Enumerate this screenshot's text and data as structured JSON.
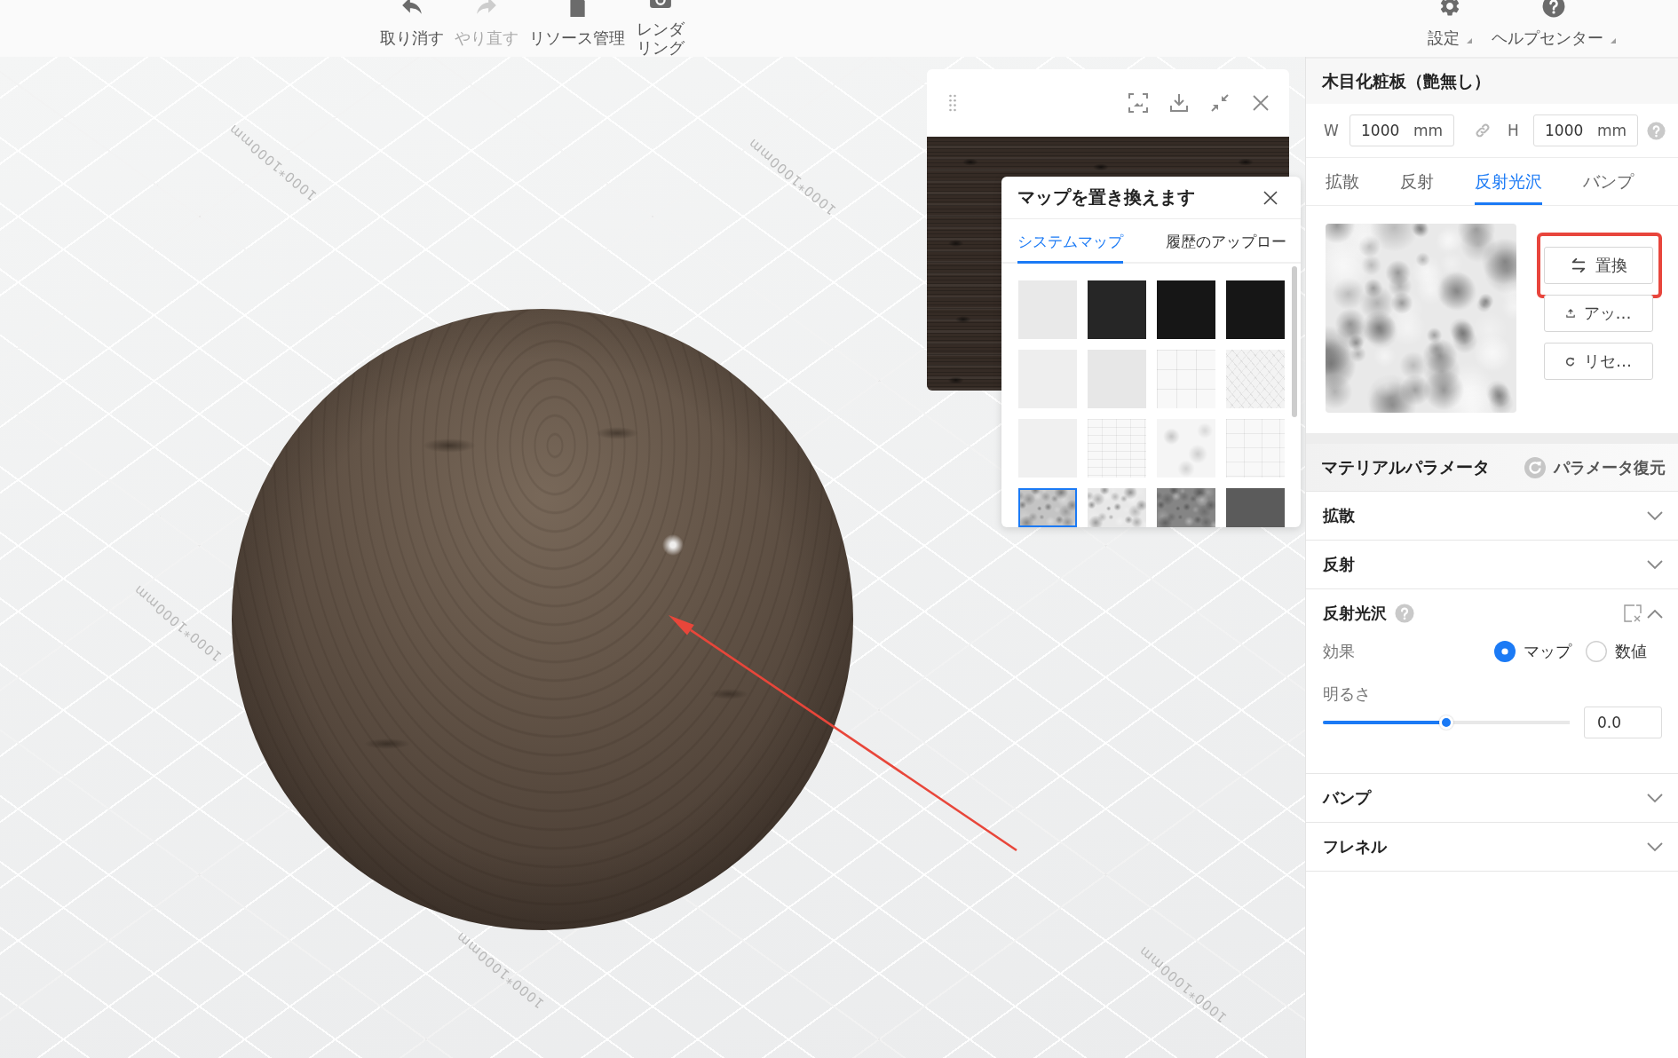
{
  "toolbar": {
    "items": [
      {
        "kind": "undo",
        "label": "取り消す",
        "disabled": false
      },
      {
        "kind": "redo",
        "label": "やり直す",
        "disabled": true
      },
      {
        "kind": "folder",
        "label": "リソース管理",
        "disabled": false
      },
      {
        "kind": "camera",
        "label": "レンダリング",
        "disabled": false
      }
    ],
    "menus": [
      {
        "kind": "gear",
        "label": "設定",
        "dropdown": true
      },
      {
        "kind": "help",
        "label": "ヘルプセンター",
        "dropdown": true
      }
    ]
  },
  "viewport": {
    "floor_labels": [
      "1000*1000mm",
      "1000*1000mm",
      "1000*1000mm",
      "1000*1000mm",
      "1000*1000mm"
    ],
    "map_dialog": {
      "title": "マップを置き換えます",
      "tabs": [
        {
          "label": "システムマップ",
          "selected": true
        },
        {
          "label": "履歴のアップロー",
          "selected": false
        }
      ],
      "thumbnails": [
        {
          "kind": "plain",
          "color": "#e9e9e9",
          "selected": false
        },
        {
          "kind": "plain",
          "color": "#262626",
          "selected": false
        },
        {
          "kind": "plain",
          "color": "#161616",
          "selected": false
        },
        {
          "kind": "plain",
          "color": "#161616",
          "selected": false
        },
        {
          "kind": "plain",
          "color": "#eeeeee",
          "selected": false
        },
        {
          "kind": "plain",
          "color": "#e7e7e7",
          "selected": false
        },
        {
          "kind": "grid",
          "color": "#f8f8f8",
          "selected": false
        },
        {
          "kind": "herringbone",
          "color": "#f3f3f3",
          "selected": false
        },
        {
          "kind": "plain",
          "color": "#f0f0f0",
          "selected": false
        },
        {
          "kind": "brick",
          "color": "#f8f8f8",
          "selected": false
        },
        {
          "kind": "marble",
          "color": "#f5f5f5",
          "selected": false
        },
        {
          "kind": "tiles",
          "color": "#f8f8f8",
          "selected": false
        },
        {
          "kind": "noise",
          "color": "#c4c4c4",
          "selected": true
        },
        {
          "kind": "noise",
          "color": "#e8e8e8",
          "selected": false
        },
        {
          "kind": "noise",
          "color": "#858585",
          "selected": false
        },
        {
          "kind": "plain",
          "color": "#5b5b5b",
          "selected": false
        }
      ]
    }
  },
  "material": {
    "title": "木目化粧板（艶無し）",
    "size": [
      {
        "label": "W",
        "value": "1000",
        "unit": "mm"
      },
      {
        "label": "H",
        "value": "1000",
        "unit": "mm"
      }
    ],
    "tabs": [
      {
        "label": "拡散",
        "selected": false
      },
      {
        "label": "反射",
        "selected": false
      },
      {
        "label": "反射光沢",
        "selected": true
      },
      {
        "label": "バンプ",
        "selected": false
      }
    ],
    "actions": [
      {
        "kind": "swap",
        "label": "置換",
        "highlighted": true
      },
      {
        "kind": "upload",
        "label": "アッ…",
        "highlighted": false
      },
      {
        "kind": "reset",
        "label": "リセ…",
        "highlighted": false
      }
    ]
  },
  "parameters": {
    "title": "マテリアルパラメータ",
    "restore": "パラメータ復元",
    "sections": [
      {
        "title": "拡散",
        "expanded": false,
        "help": false
      },
      {
        "title": "反射",
        "expanded": false,
        "help": false
      },
      {
        "title": "反射光沢",
        "expanded": true,
        "help": true,
        "effect": {
          "label": "効果",
          "options": [
            {
              "label": "マップ",
              "selected": true
            },
            {
              "label": "数値",
              "selected": false
            }
          ]
        },
        "brightness": {
          "label": "明るさ",
          "level": 0.5,
          "value": "0.0"
        }
      },
      {
        "title": "バンプ",
        "expanded": false,
        "help": false
      },
      {
        "title": "フレネル",
        "expanded": false,
        "help": false
      }
    ]
  }
}
